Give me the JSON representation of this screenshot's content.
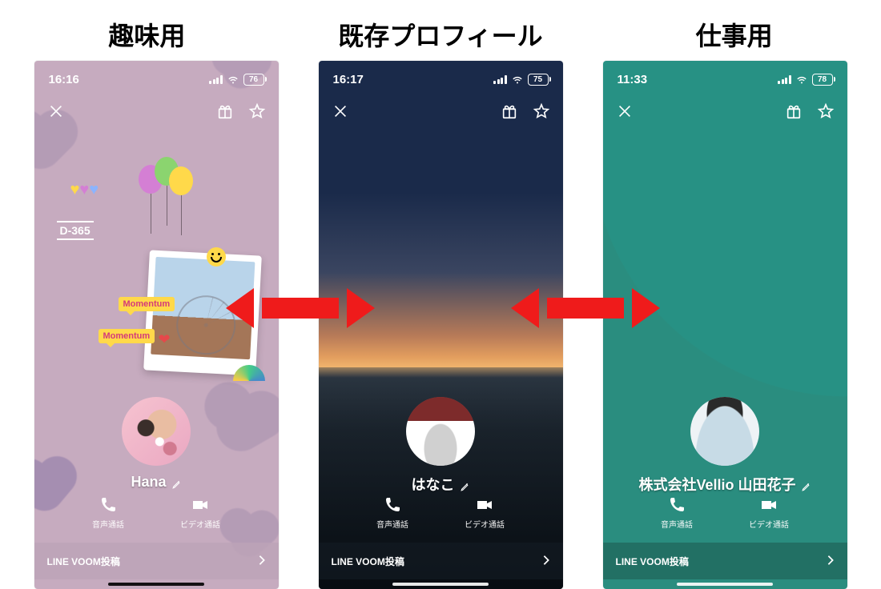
{
  "headers": {
    "hobby": "趣味用",
    "existing": "既存プロフィール",
    "work": "仕事用"
  },
  "common": {
    "voice_call": "音声通話",
    "video_call": "ビデオ通話",
    "voom": "LINE VOOM投稿"
  },
  "hobby": {
    "time": "16:16",
    "battery": "76",
    "d365": "D-365",
    "momentum": "Momentum",
    "name": "Hana"
  },
  "existing": {
    "time": "16:17",
    "battery": "75",
    "name": "はなこ"
  },
  "work": {
    "time": "11:33",
    "battery": "78",
    "name": "株式会社Vellio 山田花子"
  }
}
